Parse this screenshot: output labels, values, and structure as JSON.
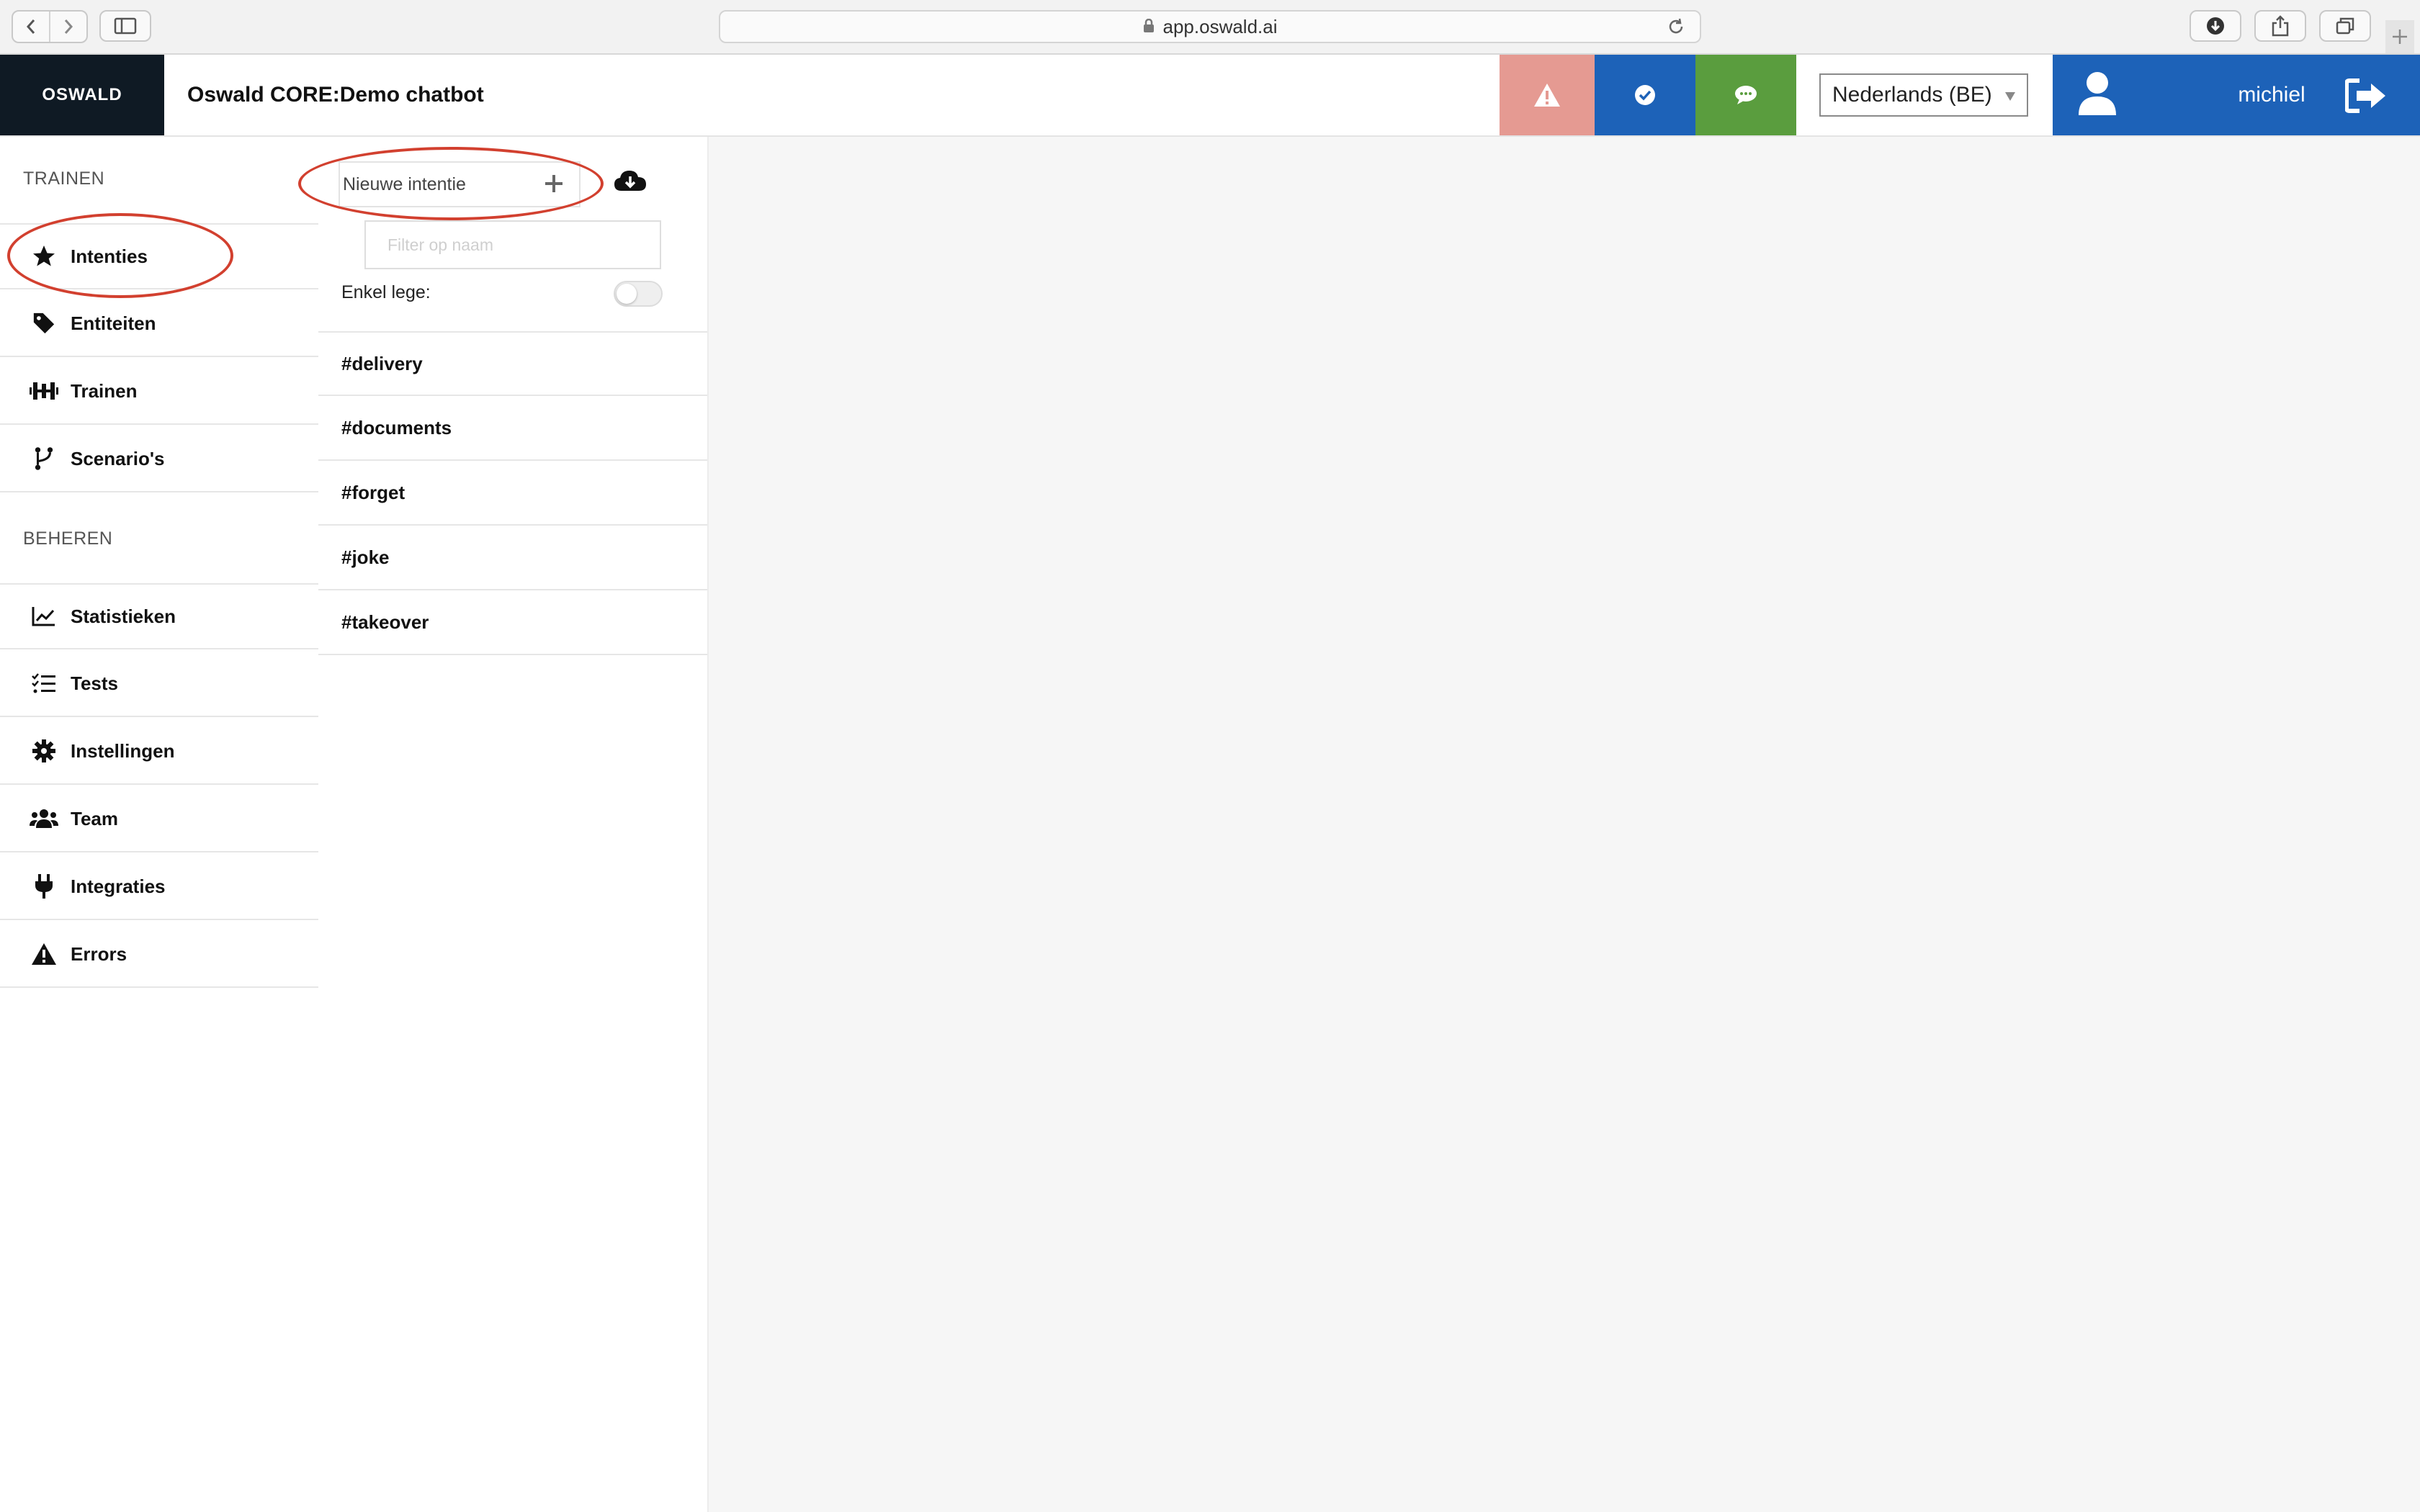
{
  "browser": {
    "url": "app.oswald.ai"
  },
  "header": {
    "logo": "OSWALD",
    "title": "Oswald CORE:Demo chatbot",
    "language": "Nederlands (BE)",
    "user": "michiel",
    "colors": {
      "alert": "#e59a92",
      "check": "#1d62b8",
      "chat": "#5a9d3e",
      "logo_bg": "#0f1a24"
    }
  },
  "sidebar": {
    "section_train": "TRAINEN",
    "section_manage": "BEHEREN",
    "train_items": [
      {
        "label": "Intenties",
        "icon": "star-icon"
      },
      {
        "label": "Entiteiten",
        "icon": "tag-icon"
      },
      {
        "label": "Trainen",
        "icon": "dumbbell-icon"
      },
      {
        "label": "Scenario's",
        "icon": "branch-icon"
      }
    ],
    "manage_items": [
      {
        "label": "Statistieken",
        "icon": "chart-icon"
      },
      {
        "label": "Tests",
        "icon": "list-check-icon"
      },
      {
        "label": "Instellingen",
        "icon": "gear-icon"
      },
      {
        "label": "Team",
        "icon": "users-icon"
      },
      {
        "label": "Integraties",
        "icon": "plug-icon"
      },
      {
        "label": "Errors",
        "icon": "warning-icon"
      }
    ]
  },
  "intents": {
    "new_label": "Nieuwe intentie",
    "filter_placeholder": "Filter op naam",
    "toggle_label": "Enkel lege:",
    "items": [
      "#delivery",
      "#documents",
      "#forget",
      "#joke",
      "#takeover"
    ]
  }
}
